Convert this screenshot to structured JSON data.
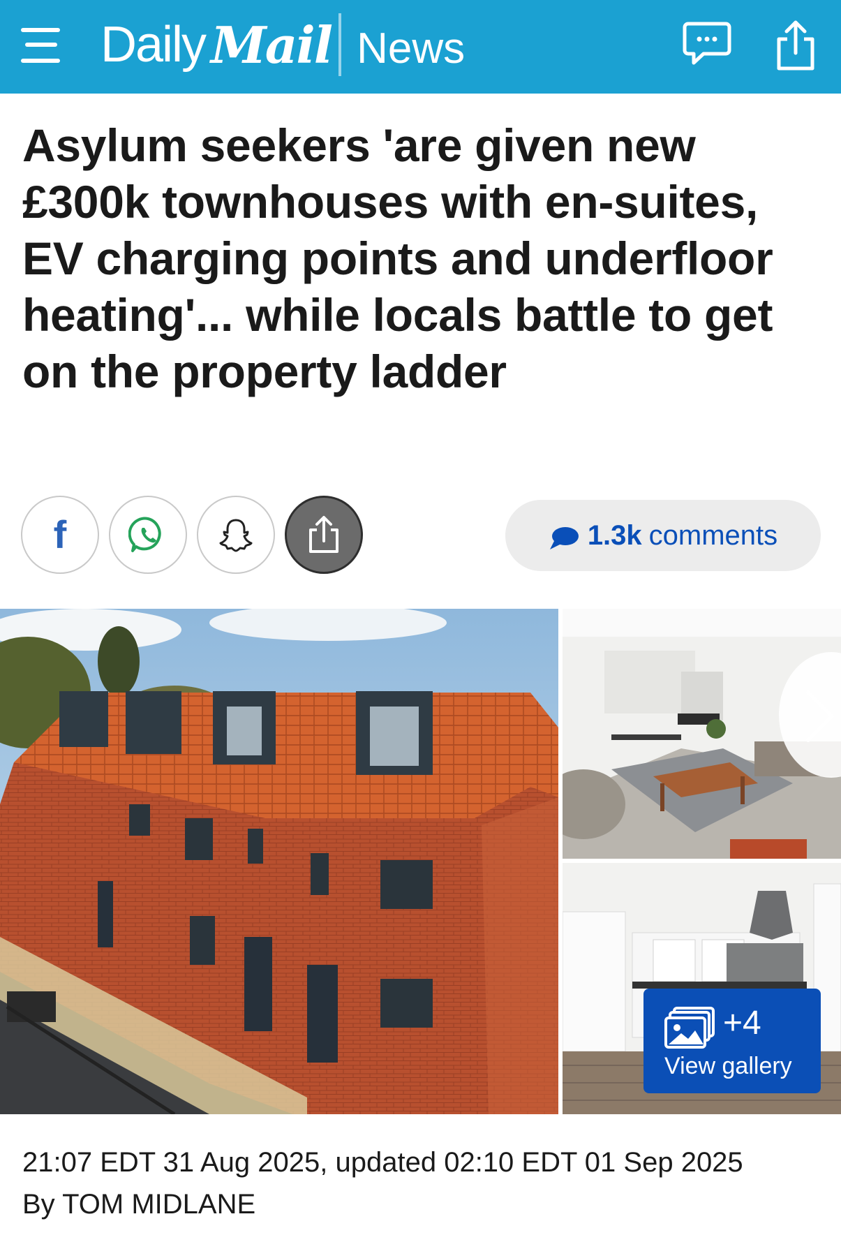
{
  "header": {
    "brand_daily": "Daily",
    "brand_mail": "Mail",
    "section": "News",
    "background_color": "#1ba1d2"
  },
  "icons": {
    "menu": "hamburger-menu-icon",
    "comments": "speech-bubble-icon",
    "share": "share-upload-icon"
  },
  "article": {
    "headline": "Asylum seekers 'are given new £300k townhouses with en-suites, EV charging points and underfloor heating'... while locals battle to get on the property ladder",
    "timestamp": "21:07 EDT 31 Aug 2025, updated 02:10 EDT 01 Sep 2025",
    "byline": "By TOM MIDLANE"
  },
  "share": {
    "facebook_glyph": "f",
    "buttons": [
      "facebook",
      "whatsapp",
      "snapchat",
      "share"
    ]
  },
  "comments": {
    "count": "1.3k",
    "label": "comments",
    "color": "#0a4fb8"
  },
  "gallery": {
    "more_count": "+4",
    "view_label": "View gallery",
    "button_color": "#0b4fb6"
  }
}
